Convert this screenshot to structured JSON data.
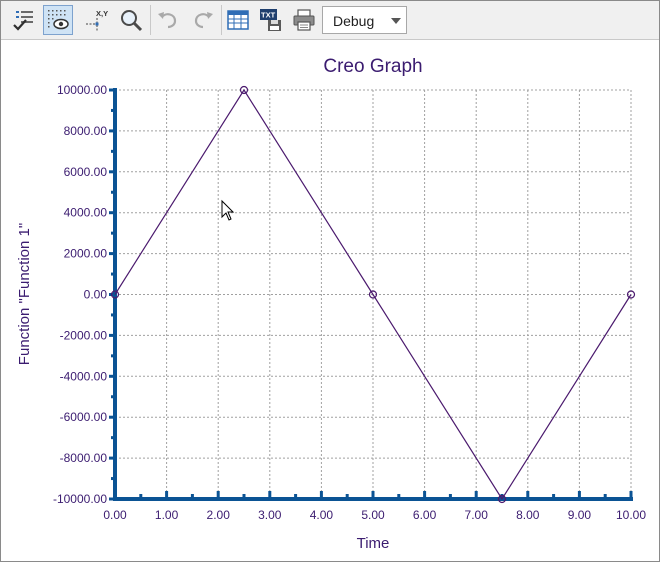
{
  "toolbar": {
    "buttons": [
      {
        "name": "format-button",
        "icon": "checklist-icon"
      },
      {
        "name": "grid-toggle-button",
        "icon": "grid-eye-icon",
        "active": true
      },
      {
        "name": "xy-readout-button",
        "icon": "xy-coordinate-icon",
        "icon_text": "X,Y"
      },
      {
        "name": "zoom-button",
        "icon": "magnifier-icon"
      },
      {
        "name": "undo-button",
        "icon": "undo-icon"
      },
      {
        "name": "redo-button",
        "icon": "redo-icon"
      },
      {
        "name": "table-button",
        "icon": "table-icon"
      },
      {
        "name": "export-text-button",
        "icon": "txt-save-icon",
        "icon_text": "TXT"
      },
      {
        "name": "print-button",
        "icon": "printer-icon"
      }
    ],
    "mode_select": {
      "value": "Debug"
    }
  },
  "colors": {
    "title": "#3b1c70",
    "text": "#3b1c70",
    "axis": "#0b5394",
    "grid": "#a0a0a0",
    "line": "#4b1a6e",
    "toolbar_bg": "#f0f0f0"
  },
  "chart_data": {
    "type": "line",
    "title": "Creo Graph",
    "xlabel": "Time",
    "ylabel": "Function \"Function 1\"",
    "xlim": [
      0,
      10
    ],
    "ylim": [
      -10000,
      10000
    ],
    "xticks": [
      "0.00",
      "1.00",
      "2.00",
      "3.00",
      "4.00",
      "5.00",
      "6.00",
      "7.00",
      "8.00",
      "9.00",
      "10.00"
    ],
    "yticks": [
      "10000.00",
      "8000.00",
      "6000.00",
      "4000.00",
      "2000.00",
      "0.00",
      "-2000.00",
      "-4000.00",
      "-6000.00",
      "-8000.00",
      "-10000.00"
    ],
    "grid": true,
    "series": [
      {
        "x": [
          0,
          2.5,
          5,
          7.5,
          10
        ],
        "y": [
          0,
          10000,
          0,
          -10000,
          0
        ]
      }
    ]
  }
}
